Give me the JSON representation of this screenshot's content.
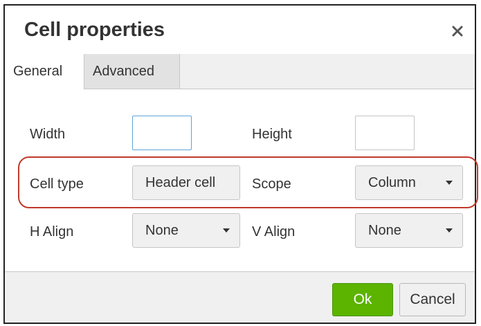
{
  "dialog": {
    "title": "Cell properties",
    "close_icon": "close-icon"
  },
  "tabs": [
    {
      "label": "General",
      "active": true
    },
    {
      "label": "Advanced",
      "active": false
    }
  ],
  "form": {
    "width": {
      "label": "Width",
      "value": ""
    },
    "height": {
      "label": "Height",
      "value": ""
    },
    "cell_type": {
      "label": "Cell type",
      "selected": "Header cell"
    },
    "scope": {
      "label": "Scope",
      "selected": "Column"
    },
    "h_align": {
      "label": "H Align",
      "selected": "None"
    },
    "v_align": {
      "label": "V Align",
      "selected": "None"
    }
  },
  "footer": {
    "ok_label": "Ok",
    "cancel_label": "Cancel"
  },
  "colors": {
    "ok_green": "#5cb300",
    "highlight_red": "#c0392b",
    "focus_blue": "#5ea3d6"
  }
}
